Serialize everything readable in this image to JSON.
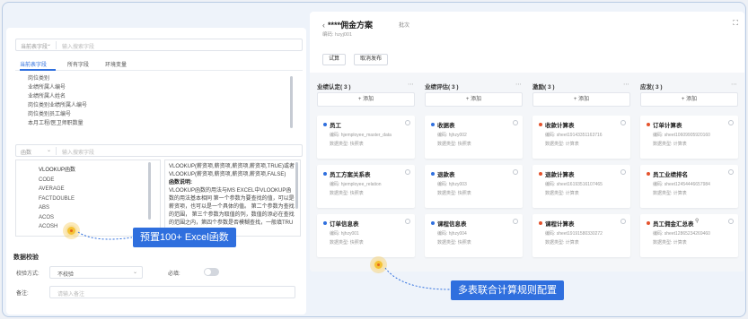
{
  "left": {
    "table_select": {
      "label": "当前表字段",
      "placeholder": "输入搜索字段"
    },
    "tabs": [
      "当前表字段",
      "所有字段",
      "环境变量"
    ],
    "fields": [
      "岗位类别",
      "业绩所属人编号",
      "业绩所属人姓名",
      "岗位类别业绩所属人编号",
      "岗位类别员工编号",
      "本月工程/医卫师职数量"
    ],
    "func_select": {
      "label": "函数",
      "placeholder": "输入搜索字段"
    },
    "functions": [
      "VLOOKUP函数",
      "CODE",
      "AVERAGE",
      "FACTDOUBLE",
      "ABS",
      "ACOS",
      "ACOSH"
    ],
    "description": {
      "line1": "VLOOKUP(薪资项,薪资项,薪资项,薪资项,TRUE)或者VLOOKUP(薪资项,薪资项,薪资项,薪资项,FALSE)",
      "title": "函数说明:",
      "body": "VLOOKUP函数的用法与MS EXCEL中VLOOKUP函数的用法基本相同  第一个参数为要查找的值，可以是薪资项，也可以是一个具体的值。 第二个参数为查找的范围， 第三个参数为取值的列，数值的添必在查找的范围之内，第四个参数是否模糊查找，一般填TRU"
    },
    "validation": {
      "title": "数据校验",
      "method_label": "校验方式:",
      "method_value": "不校验",
      "required_label": "必填:",
      "remark_label": "备注:",
      "remark_placeholder": "请输入备注"
    }
  },
  "callouts": {
    "left": "预置100+ Excel函数",
    "right": "多表联合计算规则配置"
  },
  "right": {
    "title": "****佣金方案",
    "mode": "批次",
    "code": "编码: hzyj001",
    "buttons": {
      "trial": "试算",
      "publish": "取消发布"
    },
    "add_label": "+ 添加",
    "columns": [
      {
        "title": "业绩认定( 3 )",
        "cards": [
          {
            "name": "员工",
            "code": "编码: hjemployee_master_data",
            "type": "数据类型: 快照表",
            "color": "#2f6fde"
          },
          {
            "name": "员工方案关系表",
            "code": "编码: hjemployee_relation",
            "type": "数据类型: 快照表",
            "color": "#2f6fde"
          },
          {
            "name": "订单信息表",
            "code": "编码: hjhzy001",
            "type": "数据类型: 快照表",
            "color": "#2f6fde"
          }
        ]
      },
      {
        "title": "业绩评估( 3 )",
        "cards": [
          {
            "name": "收据表",
            "code": "编码: hjhzy002",
            "type": "数据类型: 快照表",
            "color": "#2f6fde"
          },
          {
            "name": "退款表",
            "code": "编码: hjhzy003",
            "type": "数据类型: 快照表",
            "color": "#2f6fde"
          },
          {
            "name": "课程信息表",
            "code": "编码: hjhzy004",
            "type": "数据类型: 快照表",
            "color": "#2f6fde"
          }
        ]
      },
      {
        "title": "激励( 3 )",
        "cards": [
          {
            "name": "收款计算表",
            "code": "编码: sheet19143351163716",
            "type": "数据类型: 计算表",
            "color": "#e5532d"
          },
          {
            "name": "退款计算表",
            "code": "编码: sheet16193516107465",
            "type": "数据类型: 计算表",
            "color": "#e5532d"
          },
          {
            "name": "课程计算表",
            "code": "编码: sheet19191580330272",
            "type": "数据类型: 计算表",
            "color": "#e5532d"
          }
        ]
      },
      {
        "title": "应发( 3 )",
        "cards": [
          {
            "name": "订单计算表",
            "code": "编码: sheet10609905920160",
            "type": "数据类型: 计算表",
            "color": "#e5532d"
          },
          {
            "name": "员工业绩排名",
            "code": "编码: sheet12454446657984",
            "type": "数据类型: 计算表",
            "color": "#e5532d"
          },
          {
            "name": "员工佣金汇总表",
            "code": "编码: sheet12865234269460",
            "type": "数据类型: 计算表",
            "color": "#e5532d",
            "link": true
          }
        ]
      }
    ]
  }
}
